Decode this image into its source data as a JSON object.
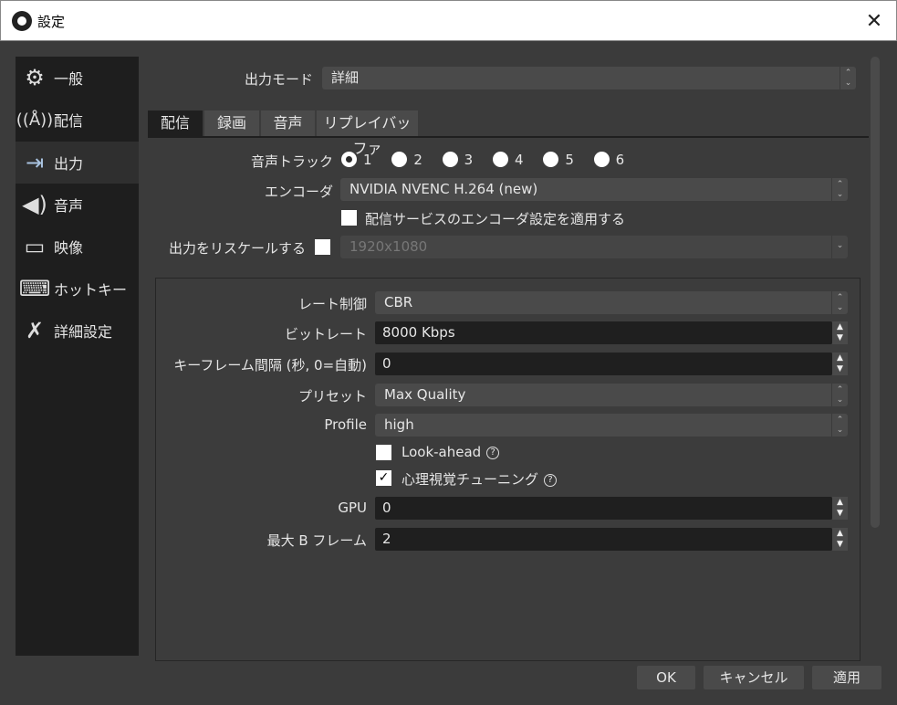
{
  "window": {
    "title": "設定",
    "close": "✕"
  },
  "sidebar": {
    "items": [
      {
        "label": "一般",
        "icon": "gear-icon",
        "glyph": "⚙"
      },
      {
        "label": "配信",
        "icon": "antenna-icon",
        "glyph": "📡"
      },
      {
        "label": "出力",
        "icon": "output-monitor-icon",
        "glyph": "🖥"
      },
      {
        "label": "音声",
        "icon": "speaker-icon",
        "glyph": "🔊"
      },
      {
        "label": "映像",
        "icon": "monitor-icon",
        "glyph": "🖵"
      },
      {
        "label": "ホットキー",
        "icon": "keyboard-icon",
        "glyph": "⌨"
      },
      {
        "label": "詳細設定",
        "icon": "tools-icon",
        "glyph": "✂"
      }
    ],
    "selected": "出力"
  },
  "output_mode": {
    "label": "出力モード",
    "value": "詳細"
  },
  "tabs": [
    "配信",
    "録画",
    "音声",
    "リプレイバッファ"
  ],
  "stream": {
    "audio_track": {
      "label": "音声トラック",
      "options": [
        "1",
        "2",
        "3",
        "4",
        "5",
        "6"
      ],
      "selected": "1"
    },
    "encoder": {
      "label": "エンコーダ",
      "value": "NVIDIA NVENC H.264 (new)"
    },
    "apply_service": {
      "label": "配信サービスのエンコーダ設定を適用する",
      "checked": false
    },
    "rescale": {
      "label": "出力をリスケールする",
      "checked": false,
      "value": "1920x1080"
    }
  },
  "encoder_settings": {
    "rate_control": {
      "label": "レート制御",
      "value": "CBR"
    },
    "bitrate": {
      "label": "ビットレート",
      "value": "8000 Kbps"
    },
    "keyframe": {
      "label": "キーフレーム間隔 (秒, 0=自動)",
      "value": "0"
    },
    "preset": {
      "label": "プリセット",
      "value": "Max Quality"
    },
    "profile": {
      "label": "Profile",
      "value": "high"
    },
    "lookahead": {
      "label": "Look-ahead",
      "checked": false
    },
    "psycho": {
      "label": "心理視覚チューニング",
      "checked": true
    },
    "gpu": {
      "label": "GPU",
      "value": "0"
    },
    "bframes": {
      "label": "最大 B フレーム",
      "value": "2"
    }
  },
  "buttons": {
    "ok": "OK",
    "cancel": "キャンセル",
    "apply": "適用"
  }
}
